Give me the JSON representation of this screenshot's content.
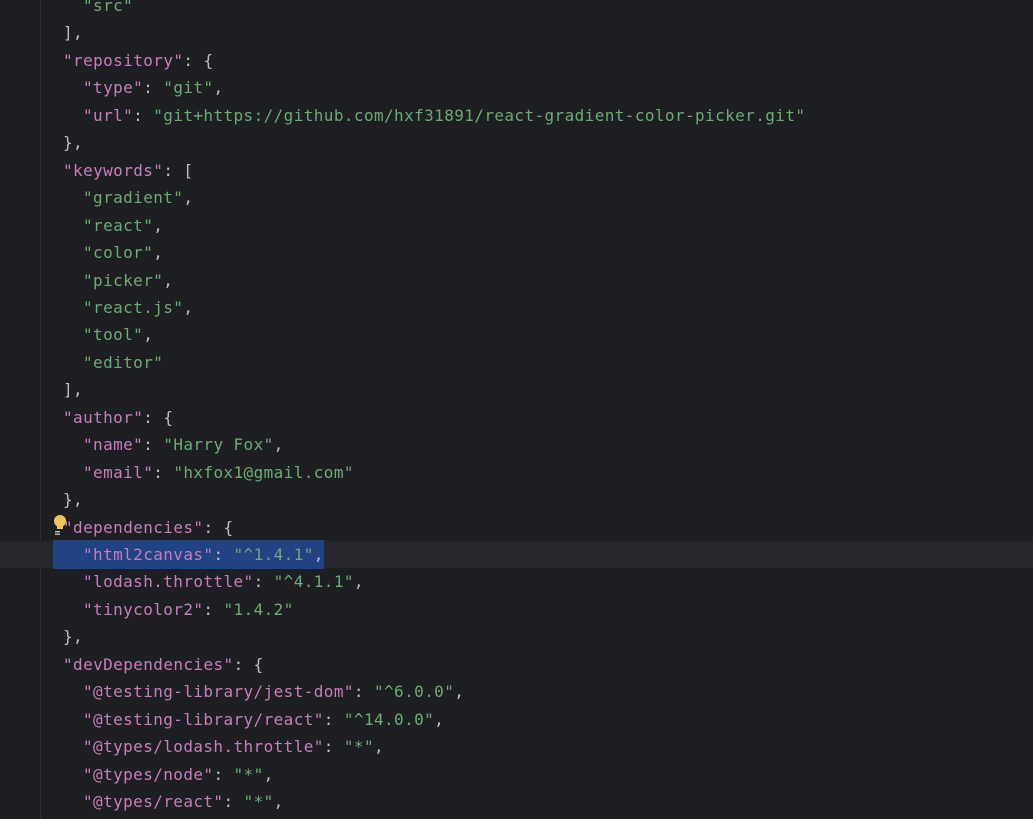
{
  "lines": [
    {
      "indent": 2,
      "parts": [
        {
          "t": "\"src\"",
          "c": "s"
        }
      ]
    },
    {
      "indent": 1,
      "parts": [
        {
          "t": "],",
          "c": "p"
        }
      ]
    },
    {
      "indent": 1,
      "parts": [
        {
          "t": "\"repository\"",
          "c": "k"
        },
        {
          "t": ": {",
          "c": "p"
        }
      ]
    },
    {
      "indent": 2,
      "parts": [
        {
          "t": "\"type\"",
          "c": "k"
        },
        {
          "t": ": ",
          "c": "p"
        },
        {
          "t": "\"git\"",
          "c": "s"
        },
        {
          "t": ",",
          "c": "p"
        }
      ]
    },
    {
      "indent": 2,
      "parts": [
        {
          "t": "\"url\"",
          "c": "k"
        },
        {
          "t": ": ",
          "c": "p"
        },
        {
          "t": "\"git+https://github.com/hxf31891/react-gradient-color-picker.git\"",
          "c": "s"
        }
      ]
    },
    {
      "indent": 1,
      "parts": [
        {
          "t": "},",
          "c": "p"
        }
      ]
    },
    {
      "indent": 1,
      "parts": [
        {
          "t": "\"keywords\"",
          "c": "k"
        },
        {
          "t": ": [",
          "c": "p"
        }
      ]
    },
    {
      "indent": 2,
      "parts": [
        {
          "t": "\"gradient\"",
          "c": "s"
        },
        {
          "t": ",",
          "c": "p"
        }
      ]
    },
    {
      "indent": 2,
      "parts": [
        {
          "t": "\"react\"",
          "c": "s"
        },
        {
          "t": ",",
          "c": "p"
        }
      ]
    },
    {
      "indent": 2,
      "parts": [
        {
          "t": "\"color\"",
          "c": "s"
        },
        {
          "t": ",",
          "c": "p"
        }
      ]
    },
    {
      "indent": 2,
      "parts": [
        {
          "t": "\"picker\"",
          "c": "s"
        },
        {
          "t": ",",
          "c": "p"
        }
      ]
    },
    {
      "indent": 2,
      "parts": [
        {
          "t": "\"react.js\"",
          "c": "s"
        },
        {
          "t": ",",
          "c": "p"
        }
      ]
    },
    {
      "indent": 2,
      "parts": [
        {
          "t": "\"tool\"",
          "c": "s"
        },
        {
          "t": ",",
          "c": "p"
        }
      ]
    },
    {
      "indent": 2,
      "parts": [
        {
          "t": "\"editor\"",
          "c": "s"
        }
      ]
    },
    {
      "indent": 1,
      "parts": [
        {
          "t": "],",
          "c": "p"
        }
      ]
    },
    {
      "indent": 1,
      "parts": [
        {
          "t": "\"author\"",
          "c": "k"
        },
        {
          "t": ": {",
          "c": "p"
        }
      ]
    },
    {
      "indent": 2,
      "parts": [
        {
          "t": "\"name\"",
          "c": "k"
        },
        {
          "t": ": ",
          "c": "p"
        },
        {
          "t": "\"Harry Fox\"",
          "c": "s"
        },
        {
          "t": ",",
          "c": "p"
        }
      ]
    },
    {
      "indent": 2,
      "parts": [
        {
          "t": "\"email\"",
          "c": "k"
        },
        {
          "t": ": ",
          "c": "p"
        },
        {
          "t": "\"hxfox1@gmail.com\"",
          "c": "s"
        }
      ]
    },
    {
      "indent": 1,
      "parts": [
        {
          "t": "},",
          "c": "p"
        }
      ]
    },
    {
      "indent": 1,
      "parts": [
        {
          "t": "\"dependencies\"",
          "c": "k"
        },
        {
          "t": ": {",
          "c": "p"
        }
      ]
    },
    {
      "indent": 2,
      "selected": true,
      "parts": [
        {
          "t": "\"html2canvas\"",
          "c": "k"
        },
        {
          "t": ": ",
          "c": "p"
        },
        {
          "t": "\"^1.4.1\"",
          "c": "s"
        },
        {
          "t": ",",
          "c": "p"
        }
      ]
    },
    {
      "indent": 2,
      "parts": [
        {
          "t": "\"lodash.throttle\"",
          "c": "k"
        },
        {
          "t": ": ",
          "c": "p"
        },
        {
          "t": "\"^4.1.1\"",
          "c": "s"
        },
        {
          "t": ",",
          "c": "p"
        }
      ]
    },
    {
      "indent": 2,
      "parts": [
        {
          "t": "\"tinycolor2\"",
          "c": "k"
        },
        {
          "t": ": ",
          "c": "p"
        },
        {
          "t": "\"1.4.2\"",
          "c": "s"
        }
      ]
    },
    {
      "indent": 1,
      "parts": [
        {
          "t": "},",
          "c": "p"
        }
      ]
    },
    {
      "indent": 1,
      "parts": [
        {
          "t": "\"devDependencies\"",
          "c": "k"
        },
        {
          "t": ": {",
          "c": "p"
        }
      ]
    },
    {
      "indent": 2,
      "parts": [
        {
          "t": "\"@testing-library/jest-dom\"",
          "c": "k"
        },
        {
          "t": ": ",
          "c": "p"
        },
        {
          "t": "\"^6.0.0\"",
          "c": "s"
        },
        {
          "t": ",",
          "c": "p"
        }
      ]
    },
    {
      "indent": 2,
      "parts": [
        {
          "t": "\"@testing-library/react\"",
          "c": "k"
        },
        {
          "t": ": ",
          "c": "p"
        },
        {
          "t": "\"^14.0.0\"",
          "c": "s"
        },
        {
          "t": ",",
          "c": "p"
        }
      ]
    },
    {
      "indent": 2,
      "parts": [
        {
          "t": "\"@types/lodash.throttle\"",
          "c": "k"
        },
        {
          "t": ": ",
          "c": "p"
        },
        {
          "t": "\"*\"",
          "c": "s"
        },
        {
          "t": ",",
          "c": "p"
        }
      ]
    },
    {
      "indent": 2,
      "parts": [
        {
          "t": "\"@types/node\"",
          "c": "k"
        },
        {
          "t": ": ",
          "c": "p"
        },
        {
          "t": "\"*\"",
          "c": "s"
        },
        {
          "t": ",",
          "c": "p"
        }
      ]
    },
    {
      "indent": 2,
      "parts": [
        {
          "t": "\"@types/react\"",
          "c": "k"
        },
        {
          "t": ": ",
          "c": "p"
        },
        {
          "t": "\"*\"",
          "c": "s"
        },
        {
          "t": ",",
          "c": "p"
        }
      ]
    }
  ],
  "intention_icon": "lightbulb-icon",
  "colors": {
    "background": "#1e1f22",
    "key": "#c77dbb",
    "string": "#6aab73",
    "punctuation": "#bcbec4",
    "selection": "#214283",
    "caret_row": "#26282e"
  }
}
